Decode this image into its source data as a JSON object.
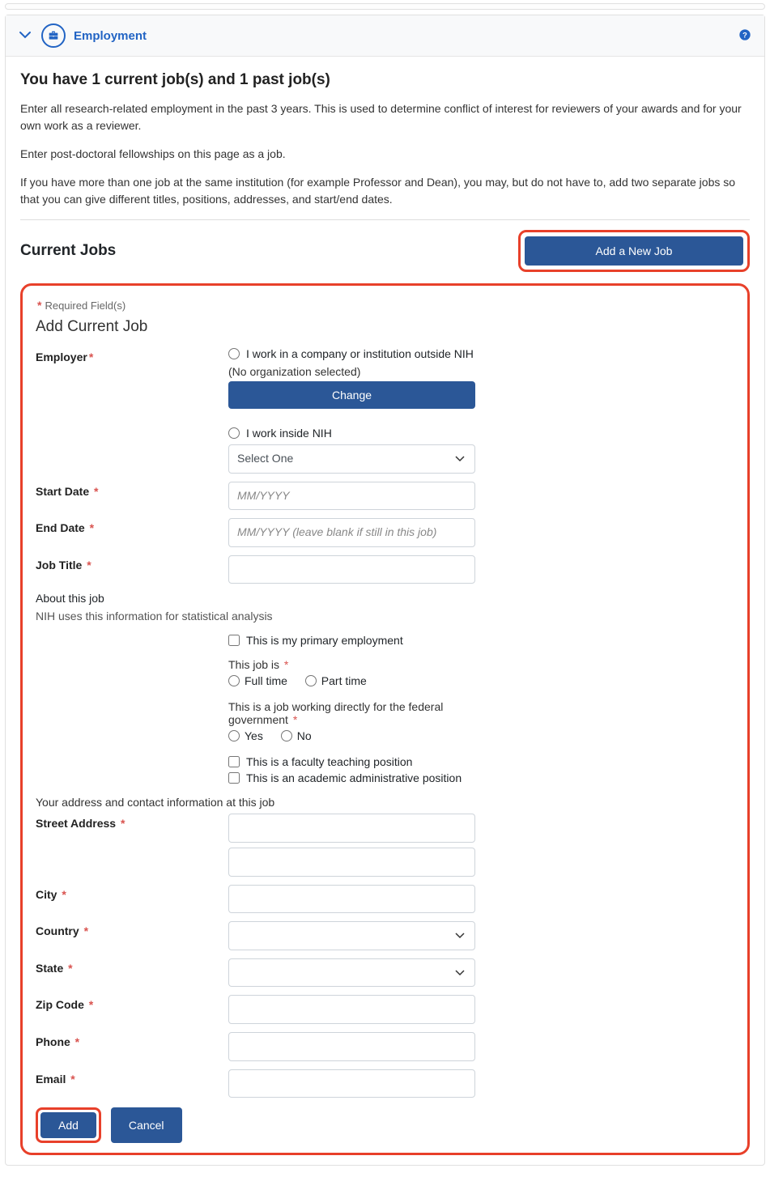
{
  "header": {
    "title": "Employment",
    "help_tooltip": "?"
  },
  "intro": {
    "heading": "You have 1 current job(s) and 1 past job(s)",
    "p1": "Enter all research-related employment in the past 3 years. This is used to determine conflict of interest for reviewers of your awards and for your own work as a reviewer.",
    "p2": "Enter post-doctoral fellowships on this page as a job.",
    "p3": "If you have more than one job at the same institution (for example Professor and Dean), you may, but do not have to, add two separate jobs so that you can give different titles, positions, addresses, and start/end dates."
  },
  "current": {
    "section_title": "Current Jobs",
    "add_new_label": "Add a New Job"
  },
  "form": {
    "required_label": "Required Field(s)",
    "title": "Add Current Job",
    "labels": {
      "employer": "Employer",
      "start_date": "Start Date",
      "end_date": "End Date",
      "job_title": "Job Title",
      "street": "Street Address",
      "city": "City",
      "country": "Country",
      "state": "State",
      "zip": "Zip Code",
      "phone": "Phone",
      "email": "Email"
    },
    "employer": {
      "outside_label": "I work in a company or institution outside NIH",
      "no_org": "(No organization selected)",
      "change_btn": "Change",
      "inside_label": "I work inside NIH",
      "select_placeholder": "Select One"
    },
    "placeholders": {
      "start_date": "MM/YYYY",
      "end_date": "MM/YYYY (leave blank if still in this job)"
    },
    "about": {
      "heading": "About this job",
      "note": "NIH uses this information for statistical analysis",
      "primary_label": "This is my primary employment",
      "jobtype_label": "This job is",
      "full_time": "Full time",
      "part_time": "Part time",
      "federal_label": "This is a job working directly for the federal government",
      "yes": "Yes",
      "no": "No",
      "faculty": "This is a faculty teaching position",
      "admin": "This is an academic administrative position"
    },
    "contact_heading": "Your address and contact information at this job",
    "buttons": {
      "add": "Add",
      "cancel": "Cancel"
    }
  }
}
